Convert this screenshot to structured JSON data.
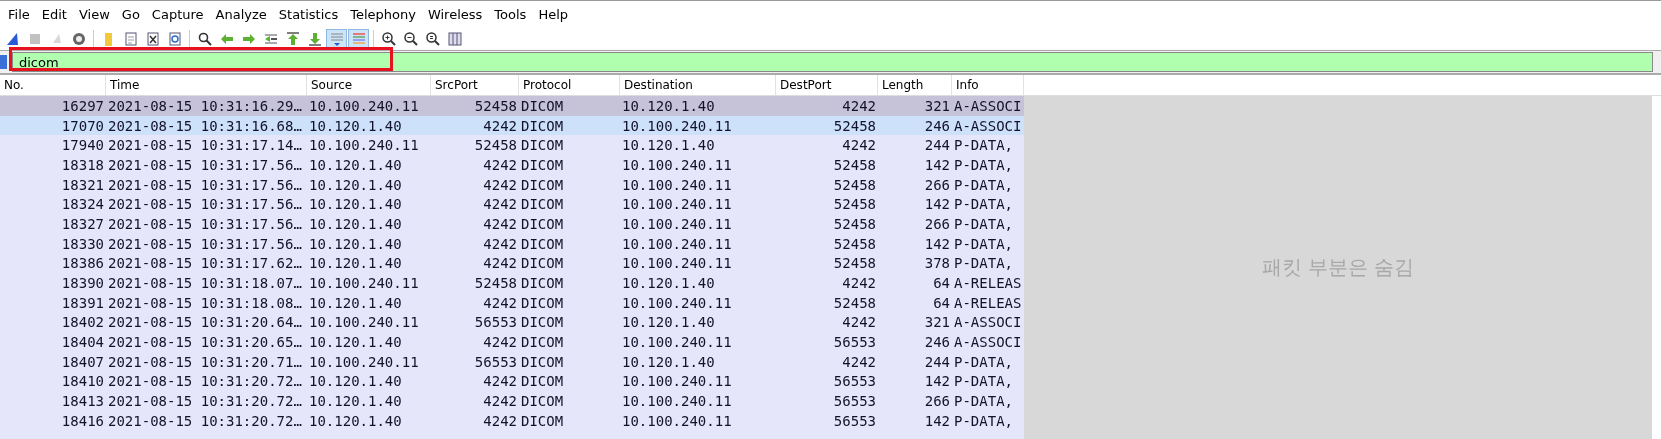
{
  "menu": [
    "File",
    "Edit",
    "View",
    "Go",
    "Capture",
    "Analyze",
    "Statistics",
    "Telephony",
    "Wireless",
    "Tools",
    "Help"
  ],
  "toolbar": [
    {
      "pressed": false,
      "disabled": false
    },
    {
      "pressed": false,
      "disabled": true
    },
    {
      "pressed": false,
      "disabled": true
    },
    {
      "pressed": false,
      "disabled": false
    },
    {
      "pressed": false,
      "disabled": false
    },
    {
      "pressed": false,
      "disabled": false
    },
    {
      "pressed": false,
      "disabled": false
    },
    {
      "pressed": false,
      "disabled": false
    },
    {
      "pressed": false,
      "disabled": false
    },
    {
      "pressed": false,
      "disabled": false
    },
    {
      "pressed": false,
      "disabled": false
    },
    {
      "pressed": false,
      "disabled": false
    },
    {
      "pressed": false,
      "disabled": false
    },
    {
      "pressed": false,
      "disabled": false
    },
    {
      "pressed": true,
      "disabled": false
    },
    {
      "pressed": true,
      "disabled": false
    },
    {
      "pressed": false,
      "disabled": false
    },
    {
      "pressed": false,
      "disabled": false
    },
    {
      "pressed": false,
      "disabled": false
    },
    {
      "pressed": false,
      "disabled": false
    }
  ],
  "filter": {
    "value": "dicom",
    "valid": true
  },
  "table": {
    "columns": [
      "No.",
      "Time",
      "Source",
      "SrcPort",
      "Protocol",
      "Destination",
      "DestPort",
      "Length",
      "Info"
    ],
    "rows": [
      {
        "cells": [
          "16297",
          "2021-08-15 10:31:16.29…",
          "10.100.240.11",
          "52458",
          "DICOM",
          "10.120.1.40",
          "4242",
          "321",
          "A-ASSOCI"
        ],
        "selected": true,
        "hovered": false
      },
      {
        "cells": [
          "17070",
          "2021-08-15 10:31:16.68…",
          "10.120.1.40",
          "4242",
          "DICOM",
          "10.100.240.11",
          "52458",
          "246",
          "A-ASSOCI"
        ],
        "selected": false,
        "hovered": true
      },
      {
        "cells": [
          "17940",
          "2021-08-15 10:31:17.14…",
          "10.100.240.11",
          "52458",
          "DICOM",
          "10.120.1.40",
          "4242",
          "244",
          "P-DATA,"
        ],
        "selected": false,
        "hovered": false
      },
      {
        "cells": [
          "18318",
          "2021-08-15 10:31:17.56…",
          "10.120.1.40",
          "4242",
          "DICOM",
          "10.100.240.11",
          "52458",
          "142",
          "P-DATA,"
        ],
        "selected": false,
        "hovered": false
      },
      {
        "cells": [
          "18321",
          "2021-08-15 10:31:17.56…",
          "10.120.1.40",
          "4242",
          "DICOM",
          "10.100.240.11",
          "52458",
          "266",
          "P-DATA,"
        ],
        "selected": false,
        "hovered": false
      },
      {
        "cells": [
          "18324",
          "2021-08-15 10:31:17.56…",
          "10.120.1.40",
          "4242",
          "DICOM",
          "10.100.240.11",
          "52458",
          "142",
          "P-DATA,"
        ],
        "selected": false,
        "hovered": false
      },
      {
        "cells": [
          "18327",
          "2021-08-15 10:31:17.56…",
          "10.120.1.40",
          "4242",
          "DICOM",
          "10.100.240.11",
          "52458",
          "266",
          "P-DATA,"
        ],
        "selected": false,
        "hovered": false
      },
      {
        "cells": [
          "18330",
          "2021-08-15 10:31:17.56…",
          "10.120.1.40",
          "4242",
          "DICOM",
          "10.100.240.11",
          "52458",
          "142",
          "P-DATA,"
        ],
        "selected": false,
        "hovered": false
      },
      {
        "cells": [
          "18386",
          "2021-08-15 10:31:17.62…",
          "10.120.1.40",
          "4242",
          "DICOM",
          "10.100.240.11",
          "52458",
          "378",
          "P-DATA,"
        ],
        "selected": false,
        "hovered": false
      },
      {
        "cells": [
          "18390",
          "2021-08-15 10:31:18.07…",
          "10.100.240.11",
          "52458",
          "DICOM",
          "10.120.1.40",
          "4242",
          "64",
          "A-RELEAS"
        ],
        "selected": false,
        "hovered": false
      },
      {
        "cells": [
          "18391",
          "2021-08-15 10:31:18.08…",
          "10.120.1.40",
          "4242",
          "DICOM",
          "10.100.240.11",
          "52458",
          "64",
          "A-RELEAS"
        ],
        "selected": false,
        "hovered": false
      },
      {
        "cells": [
          "18402",
          "2021-08-15 10:31:20.64…",
          "10.100.240.11",
          "56553",
          "DICOM",
          "10.120.1.40",
          "4242",
          "321",
          "A-ASSOCI"
        ],
        "selected": false,
        "hovered": false
      },
      {
        "cells": [
          "18404",
          "2021-08-15 10:31:20.65…",
          "10.120.1.40",
          "4242",
          "DICOM",
          "10.100.240.11",
          "56553",
          "246",
          "A-ASSOCI"
        ],
        "selected": false,
        "hovered": false
      },
      {
        "cells": [
          "18407",
          "2021-08-15 10:31:20.71…",
          "10.100.240.11",
          "56553",
          "DICOM",
          "10.120.1.40",
          "4242",
          "244",
          "P-DATA,"
        ],
        "selected": false,
        "hovered": false
      },
      {
        "cells": [
          "18410",
          "2021-08-15 10:31:20.72…",
          "10.120.1.40",
          "4242",
          "DICOM",
          "10.100.240.11",
          "56553",
          "142",
          "P-DATA,"
        ],
        "selected": false,
        "hovered": false
      },
      {
        "cells": [
          "18413",
          "2021-08-15 10:31:20.72…",
          "10.120.1.40",
          "4242",
          "DICOM",
          "10.100.240.11",
          "56553",
          "266",
          "P-DATA,"
        ],
        "selected": false,
        "hovered": false
      },
      {
        "cells": [
          "18416",
          "2021-08-15 10:31:20.72…",
          "10.120.1.40",
          "4242",
          "DICOM",
          "10.100.240.11",
          "56553",
          "142",
          "P-DATA,"
        ],
        "selected": false,
        "hovered": false
      }
    ]
  },
  "hidden_pane": {
    "message": "패킷 부분은 숨김"
  }
}
